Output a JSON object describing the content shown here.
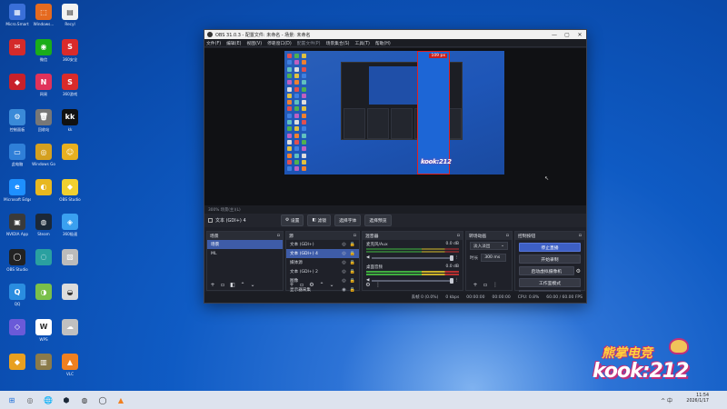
{
  "desktop": {
    "icons": [
      {
        "label": "Micro.Smart",
        "color": "#3a6fd8",
        "glyph": "▦"
      },
      {
        "label": "Windows...",
        "color": "#e56a1f",
        "glyph": "⬚"
      },
      {
        "label": "Recyl",
        "color": "#f2f2f2",
        "glyph": "▤"
      },
      {
        "label": "",
        "color": "#d42a2a",
        "glyph": "✉"
      },
      {
        "label": "微信",
        "color": "#1aad19",
        "glyph": "◉"
      },
      {
        "label": "360安全",
        "color": "#d92b2b",
        "glyph": "S"
      },
      {
        "label": "",
        "color": "#c8202a",
        "glyph": "◆"
      },
      {
        "label": "网易",
        "color": "#e0325a",
        "glyph": "N"
      },
      {
        "label": "360游戏",
        "color": "#d92b2b",
        "glyph": "S"
      },
      {
        "label": "控制面板",
        "color": "#3a8ad8",
        "glyph": "⚙"
      },
      {
        "label": "回收站",
        "color": "#777",
        "glyph": "🗑"
      },
      {
        "label": "kk",
        "color": "#111",
        "glyph": "kk"
      },
      {
        "label": "此电脑",
        "color": "#2f7fd8",
        "glyph": "▭"
      },
      {
        "label": "Windows Go",
        "color": "#d4a020",
        "glyph": "◎"
      },
      {
        "label": "",
        "color": "#e8b020",
        "glyph": "☺"
      },
      {
        "label": "Microsoft Edge",
        "color": "#1e90ff",
        "glyph": "e"
      },
      {
        "label": "",
        "color": "#e8b820",
        "glyph": "◐"
      },
      {
        "label": "OBS Studio",
        "color": "#f0d030",
        "glyph": "◆"
      },
      {
        "label": "NVIDIA App",
        "color": "#3a3a3a",
        "glyph": "▣"
      },
      {
        "label": "Steam",
        "color": "#1b2838",
        "glyph": "◍"
      },
      {
        "label": "360极速",
        "color": "#3aa0f0",
        "glyph": "◈"
      },
      {
        "label": "OBS Studio",
        "color": "#222",
        "glyph": "◯"
      },
      {
        "label": "",
        "color": "#2aa0a0",
        "glyph": "◌"
      },
      {
        "label": "",
        "color": "#bbb",
        "glyph": "▧"
      },
      {
        "label": "QQ",
        "color": "#2a8de0",
        "glyph": "Q"
      },
      {
        "label": "",
        "color": "#7ac04a",
        "glyph": "◑"
      },
      {
        "label": "",
        "color": "#dcdcdc",
        "glyph": "◒"
      },
      {
        "label": "",
        "color": "#6a5ad8",
        "glyph": "◇"
      },
      {
        "label": "WPS",
        "color": "#ffffff",
        "glyph": "W"
      },
      {
        "label": "",
        "color": "#c0c0c0",
        "glyph": "☁"
      },
      {
        "label": "",
        "color": "#e8a020",
        "glyph": "◆"
      },
      {
        "label": "",
        "color": "#8a7a4a",
        "glyph": "▥"
      },
      {
        "label": "VLC",
        "color": "#f08020",
        "glyph": "▲"
      }
    ]
  },
  "obs": {
    "title": "OBS 31.0.3 - 配置文件: 未命名 - 场景: 未命名",
    "window_buttons": [
      "—",
      "▢",
      "✕"
    ],
    "menu": [
      "文件(F)",
      "编辑(E)",
      "视图(V)",
      "停靠窗口(D)",
      "配置文件(P)",
      "场景集合(S)",
      "工具(T)",
      "帮助(H)"
    ],
    "preview_size_label": "109 px",
    "preview_logo": "kook:212",
    "scene_info": "300%  场景(主)(L)",
    "source_bar": {
      "name": "文本 (GDI+) 4",
      "buttons": [
        "设置",
        "滤镜",
        "选择字体",
        "选择预览"
      ]
    },
    "scenes": {
      "title": "场景",
      "items": [
        "场景",
        "ML"
      ]
    },
    "sources": {
      "title": "源",
      "items": [
        "文本 (GDI+)",
        "文本 (GDI+) 4",
        "媒体源",
        "文本 (GDI+) 2",
        "图像",
        "显示器采集"
      ]
    },
    "mixer": {
      "title": "混音器",
      "channels": [
        {
          "name": "麦克风/Aux",
          "db": "0.0 dB"
        },
        {
          "name": "桌面音频",
          "db": "0.0 dB"
        }
      ]
    },
    "transitions": {
      "title": "转场动画",
      "selected": "淡入淡出",
      "duration_label": "时长",
      "duration": "300 ms"
    },
    "controls": {
      "title": "控制按钮",
      "buttons": [
        "停止直播",
        "开始录制",
        "启动虚拟摄像机",
        "工作室模式",
        "设置",
        "退出"
      ]
    },
    "status": {
      "dropped": "丢帧 0 (0.0%)",
      "kbps": "0 kbps",
      "time1": "00:00:00",
      "time2": "00:00:00",
      "cpu": "CPU: 0.8%",
      "fps": "60.00 / 60.00 FPS"
    }
  },
  "brand": {
    "line1": "熊掌电竞",
    "line2": "kook:212"
  },
  "taskbar": {
    "apps": [
      "⊞",
      "◎",
      "🌐",
      "⬢",
      "◍",
      "◯",
      "▲"
    ],
    "tray": "^ 中",
    "time": "11:54",
    "date": "2026/1/17"
  }
}
